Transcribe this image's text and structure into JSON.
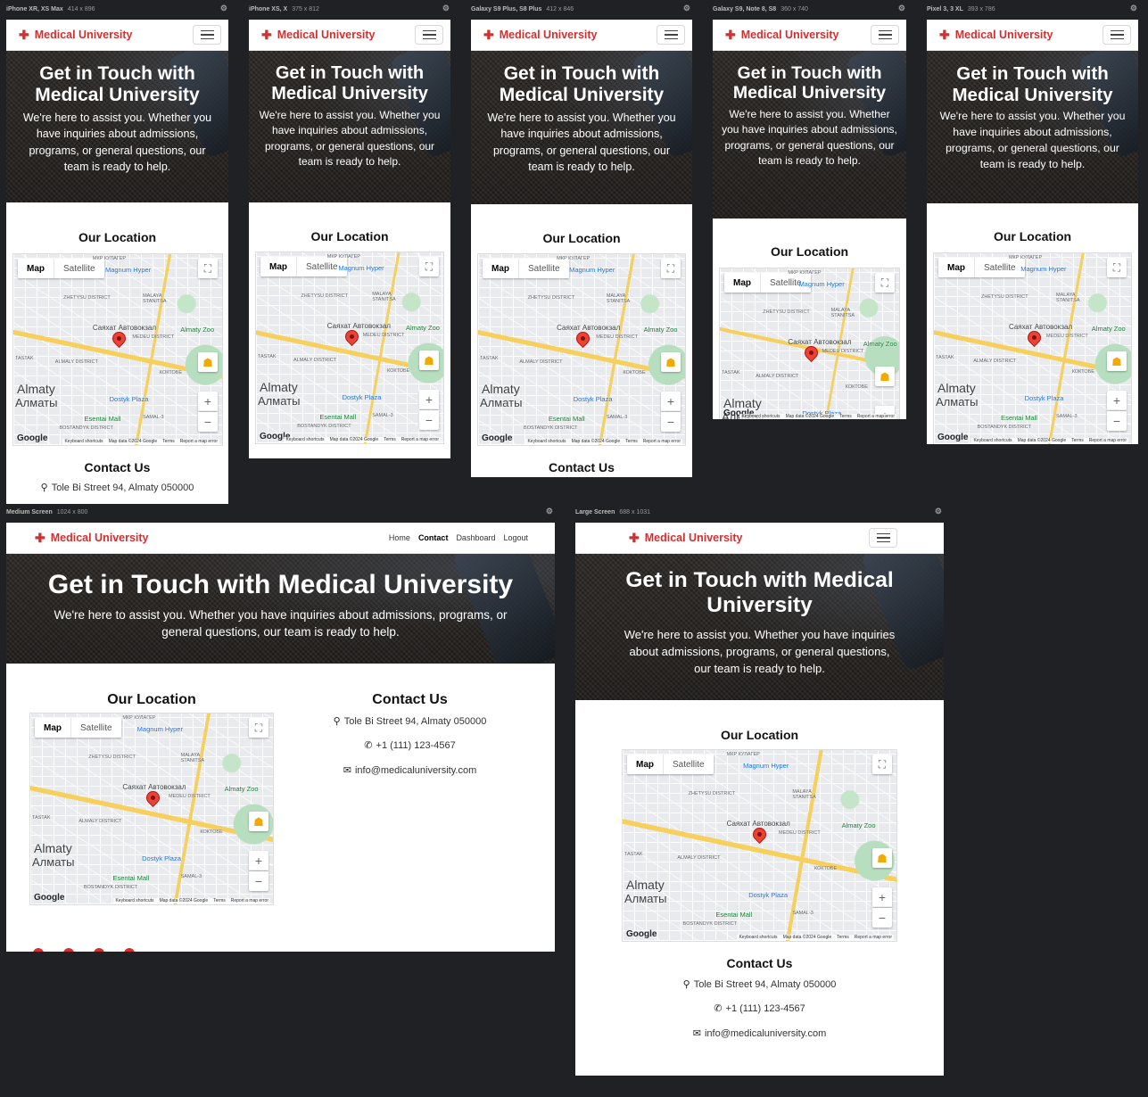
{
  "brand": {
    "name": "Medical University",
    "icon": "medical-cross-icon",
    "color": "#d32f2f"
  },
  "nav": {
    "links": [
      "Home",
      "Contact",
      "Dashboard",
      "Logout"
    ],
    "active": "Contact"
  },
  "hero": {
    "title": "Get in Touch with Medical University",
    "text": "We're here to assist you. Whether you have inquiries about admissions, programs, or general questions, our team is ready to help."
  },
  "location": {
    "title": "Our Location"
  },
  "contact": {
    "title": "Contact Us",
    "address": "Tole Bi Street 94, Almaty 050000",
    "phone": "+1 (111) 123-4567",
    "email": "info@medicaluniversity.com"
  },
  "map": {
    "type_map": "Map",
    "type_satellite": "Satellite",
    "city_latin": "Almaty",
    "city_cyrillic": "Алматы",
    "poi_station": "Саяхат Автовокзал",
    "poi_hyper": "Magnum Hyper",
    "poi_zoo": "Almaty Zoo",
    "poi_dostyk": "Dostyk Plaza",
    "poi_esentai": "Esentai Mall",
    "district_almaly": "ALMALY DISTRICT",
    "district_medeu": "MEDEU DISTRICT",
    "district_zhetysu": "ZHETYSU DISTRICT",
    "district_malaya": "MALAYA STANITSA",
    "district_bostandyk": "BOSTANDYK DISTRICT",
    "district_mkr_kulager": "МКР КУЛАГЕР",
    "district_samal": "SAMAL-3",
    "district_koktobe": "КОКТОБЕ",
    "district_tastak": "TASTAK",
    "google": "Google",
    "footer_keyboard": "Keyboard shortcuts",
    "footer_data": "Map data ©2024 Google",
    "footer_terms": "Terms",
    "footer_report": "Report a map error"
  },
  "frames": [
    {
      "label": "iPhone XR, XS Max",
      "dims": "414 x 896"
    },
    {
      "label": "iPhone XS, X",
      "dims": "375 x 812"
    },
    {
      "label": "Galaxy S9 Plus, S8 Plus",
      "dims": "412 x 846"
    },
    {
      "label": "Galaxy S9, Note 8, S8",
      "dims": "360 x 740"
    },
    {
      "label": "Pixel 3, 3 XL",
      "dims": "393 x 786"
    },
    {
      "label": "Medium Screen",
      "dims": "1024 x 800"
    },
    {
      "label": "Large Screen",
      "dims": "688 x 1031"
    }
  ],
  "colors": {
    "accent": "#d32f2f",
    "canvas": "#202124",
    "hero_bg": "#262321"
  }
}
